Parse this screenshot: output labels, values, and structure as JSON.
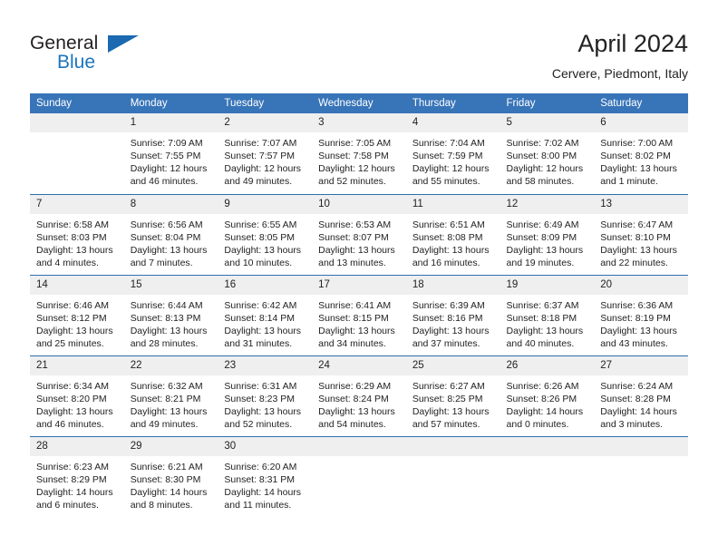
{
  "brand": {
    "line1": "General",
    "line2": "Blue",
    "flag_color": "#1b69b0",
    "text_color": "#231f20",
    "accent_color": "#1c75bc"
  },
  "header": {
    "title": "April 2024",
    "subtitle": "Cervere, Piedmont, Italy"
  },
  "theme": {
    "header_bg": "#3874b8",
    "row_divider": "#2f6fb0",
    "daynum_bg": "#efefef",
    "text": "#222222"
  },
  "weekday_headers": [
    "Sunday",
    "Monday",
    "Tuesday",
    "Wednesday",
    "Thursday",
    "Friday",
    "Saturday"
  ],
  "weeks": [
    [
      {
        "day": "",
        "sunrise": "",
        "sunset": "",
        "daylight1": "",
        "daylight2": ""
      },
      {
        "day": "1",
        "sunrise": "Sunrise: 7:09 AM",
        "sunset": "Sunset: 7:55 PM",
        "daylight1": "Daylight: 12 hours",
        "daylight2": "and 46 minutes."
      },
      {
        "day": "2",
        "sunrise": "Sunrise: 7:07 AM",
        "sunset": "Sunset: 7:57 PM",
        "daylight1": "Daylight: 12 hours",
        "daylight2": "and 49 minutes."
      },
      {
        "day": "3",
        "sunrise": "Sunrise: 7:05 AM",
        "sunset": "Sunset: 7:58 PM",
        "daylight1": "Daylight: 12 hours",
        "daylight2": "and 52 minutes."
      },
      {
        "day": "4",
        "sunrise": "Sunrise: 7:04 AM",
        "sunset": "Sunset: 7:59 PM",
        "daylight1": "Daylight: 12 hours",
        "daylight2": "and 55 minutes."
      },
      {
        "day": "5",
        "sunrise": "Sunrise: 7:02 AM",
        "sunset": "Sunset: 8:00 PM",
        "daylight1": "Daylight: 12 hours",
        "daylight2": "and 58 minutes."
      },
      {
        "day": "6",
        "sunrise": "Sunrise: 7:00 AM",
        "sunset": "Sunset: 8:02 PM",
        "daylight1": "Daylight: 13 hours",
        "daylight2": "and 1 minute."
      }
    ],
    [
      {
        "day": "7",
        "sunrise": "Sunrise: 6:58 AM",
        "sunset": "Sunset: 8:03 PM",
        "daylight1": "Daylight: 13 hours",
        "daylight2": "and 4 minutes."
      },
      {
        "day": "8",
        "sunrise": "Sunrise: 6:56 AM",
        "sunset": "Sunset: 8:04 PM",
        "daylight1": "Daylight: 13 hours",
        "daylight2": "and 7 minutes."
      },
      {
        "day": "9",
        "sunrise": "Sunrise: 6:55 AM",
        "sunset": "Sunset: 8:05 PM",
        "daylight1": "Daylight: 13 hours",
        "daylight2": "and 10 minutes."
      },
      {
        "day": "10",
        "sunrise": "Sunrise: 6:53 AM",
        "sunset": "Sunset: 8:07 PM",
        "daylight1": "Daylight: 13 hours",
        "daylight2": "and 13 minutes."
      },
      {
        "day": "11",
        "sunrise": "Sunrise: 6:51 AM",
        "sunset": "Sunset: 8:08 PM",
        "daylight1": "Daylight: 13 hours",
        "daylight2": "and 16 minutes."
      },
      {
        "day": "12",
        "sunrise": "Sunrise: 6:49 AM",
        "sunset": "Sunset: 8:09 PM",
        "daylight1": "Daylight: 13 hours",
        "daylight2": "and 19 minutes."
      },
      {
        "day": "13",
        "sunrise": "Sunrise: 6:47 AM",
        "sunset": "Sunset: 8:10 PM",
        "daylight1": "Daylight: 13 hours",
        "daylight2": "and 22 minutes."
      }
    ],
    [
      {
        "day": "14",
        "sunrise": "Sunrise: 6:46 AM",
        "sunset": "Sunset: 8:12 PM",
        "daylight1": "Daylight: 13 hours",
        "daylight2": "and 25 minutes."
      },
      {
        "day": "15",
        "sunrise": "Sunrise: 6:44 AM",
        "sunset": "Sunset: 8:13 PM",
        "daylight1": "Daylight: 13 hours",
        "daylight2": "and 28 minutes."
      },
      {
        "day": "16",
        "sunrise": "Sunrise: 6:42 AM",
        "sunset": "Sunset: 8:14 PM",
        "daylight1": "Daylight: 13 hours",
        "daylight2": "and 31 minutes."
      },
      {
        "day": "17",
        "sunrise": "Sunrise: 6:41 AM",
        "sunset": "Sunset: 8:15 PM",
        "daylight1": "Daylight: 13 hours",
        "daylight2": "and 34 minutes."
      },
      {
        "day": "18",
        "sunrise": "Sunrise: 6:39 AM",
        "sunset": "Sunset: 8:16 PM",
        "daylight1": "Daylight: 13 hours",
        "daylight2": "and 37 minutes."
      },
      {
        "day": "19",
        "sunrise": "Sunrise: 6:37 AM",
        "sunset": "Sunset: 8:18 PM",
        "daylight1": "Daylight: 13 hours",
        "daylight2": "and 40 minutes."
      },
      {
        "day": "20",
        "sunrise": "Sunrise: 6:36 AM",
        "sunset": "Sunset: 8:19 PM",
        "daylight1": "Daylight: 13 hours",
        "daylight2": "and 43 minutes."
      }
    ],
    [
      {
        "day": "21",
        "sunrise": "Sunrise: 6:34 AM",
        "sunset": "Sunset: 8:20 PM",
        "daylight1": "Daylight: 13 hours",
        "daylight2": "and 46 minutes."
      },
      {
        "day": "22",
        "sunrise": "Sunrise: 6:32 AM",
        "sunset": "Sunset: 8:21 PM",
        "daylight1": "Daylight: 13 hours",
        "daylight2": "and 49 minutes."
      },
      {
        "day": "23",
        "sunrise": "Sunrise: 6:31 AM",
        "sunset": "Sunset: 8:23 PM",
        "daylight1": "Daylight: 13 hours",
        "daylight2": "and 52 minutes."
      },
      {
        "day": "24",
        "sunrise": "Sunrise: 6:29 AM",
        "sunset": "Sunset: 8:24 PM",
        "daylight1": "Daylight: 13 hours",
        "daylight2": "and 54 minutes."
      },
      {
        "day": "25",
        "sunrise": "Sunrise: 6:27 AM",
        "sunset": "Sunset: 8:25 PM",
        "daylight1": "Daylight: 13 hours",
        "daylight2": "and 57 minutes."
      },
      {
        "day": "26",
        "sunrise": "Sunrise: 6:26 AM",
        "sunset": "Sunset: 8:26 PM",
        "daylight1": "Daylight: 14 hours",
        "daylight2": "and 0 minutes."
      },
      {
        "day": "27",
        "sunrise": "Sunrise: 6:24 AM",
        "sunset": "Sunset: 8:28 PM",
        "daylight1": "Daylight: 14 hours",
        "daylight2": "and 3 minutes."
      }
    ],
    [
      {
        "day": "28",
        "sunrise": "Sunrise: 6:23 AM",
        "sunset": "Sunset: 8:29 PM",
        "daylight1": "Daylight: 14 hours",
        "daylight2": "and 6 minutes."
      },
      {
        "day": "29",
        "sunrise": "Sunrise: 6:21 AM",
        "sunset": "Sunset: 8:30 PM",
        "daylight1": "Daylight: 14 hours",
        "daylight2": "and 8 minutes."
      },
      {
        "day": "30",
        "sunrise": "Sunrise: 6:20 AM",
        "sunset": "Sunset: 8:31 PM",
        "daylight1": "Daylight: 14 hours",
        "daylight2": "and 11 minutes."
      },
      {
        "day": "",
        "sunrise": "",
        "sunset": "",
        "daylight1": "",
        "daylight2": ""
      },
      {
        "day": "",
        "sunrise": "",
        "sunset": "",
        "daylight1": "",
        "daylight2": ""
      },
      {
        "day": "",
        "sunrise": "",
        "sunset": "",
        "daylight1": "",
        "daylight2": ""
      },
      {
        "day": "",
        "sunrise": "",
        "sunset": "",
        "daylight1": "",
        "daylight2": ""
      }
    ]
  ]
}
